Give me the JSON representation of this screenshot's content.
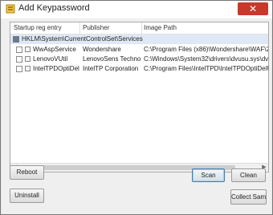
{
  "window": {
    "title": "Add Keypassword",
    "close_glyph": "✕",
    "app_icon": "app-icon"
  },
  "list": {
    "columns": [
      "Startup reg entry",
      "Publisher",
      "Image Path"
    ],
    "root_row": "HKLM\\System\\CurrentControlSet\\Services",
    "rows": [
      {
        "entry": "WwAspService",
        "publisher": "Wondershare",
        "path": "C:\\Program Files (x86)\\Wondershare\\WAF\\2.16.0\\WsAspSvc"
      },
      {
        "entry": "LenovoVUtil",
        "publisher": "LenovoSens Technology C...",
        "path": "C:\\Windows\\System32\\drivers\\dvusu.sys\\dvusu.sys"
      },
      {
        "entry": "IntelTPDOptiDelUtil",
        "publisher": "IntelTP Corporation",
        "path": "C:\\Program Files\\IntelTPD\\IntelTPDOptiDelUtil.exe"
      }
    ]
  },
  "buttons": {
    "reboot": "Reboot",
    "scan": "Scan",
    "clean": "Clean",
    "uninstall": "Uninstall",
    "collect_sample": "Collect Sample"
  }
}
